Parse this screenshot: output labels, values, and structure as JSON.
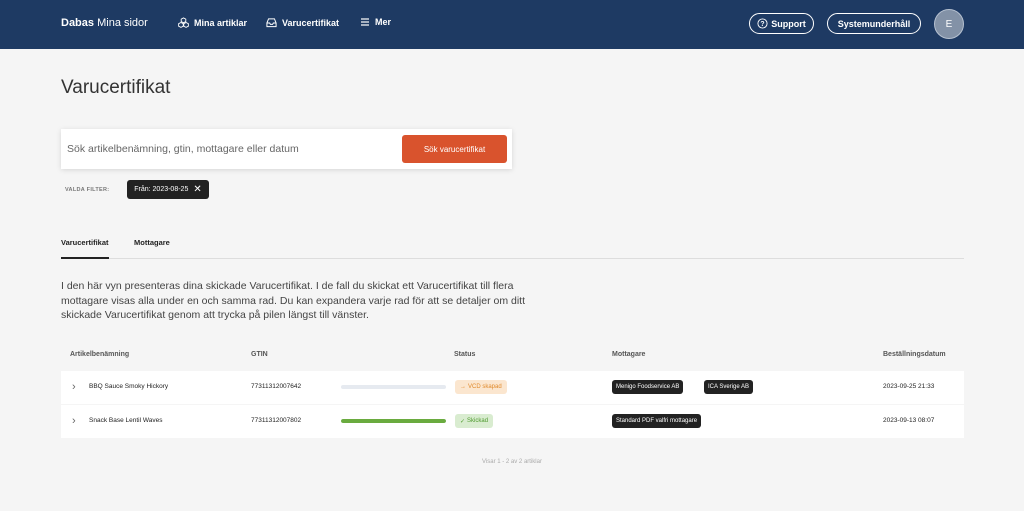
{
  "nav": {
    "brand_bold": "Dabas",
    "brand_rest": "Mina sidor",
    "links": [
      {
        "label": "Mina artiklar",
        "icon": "cubes-icon"
      },
      {
        "label": "Varucertifikat",
        "icon": "inbox-icon"
      },
      {
        "label": "Mer",
        "icon": "menu-icon"
      }
    ],
    "support_label": "Support",
    "maintenance_label": "Systemunderhåll",
    "avatar_initial": "E"
  },
  "page": {
    "title": "Varucertifikat"
  },
  "search": {
    "placeholder": "Sök artikelbenämning, gtin, mottagare eller datum",
    "value": "",
    "button_label": "Sök varucertifikat"
  },
  "filters": {
    "label": "VALDA FILTER:",
    "chips": [
      {
        "label": "Från: 2023-08-25"
      }
    ]
  },
  "tabs": [
    {
      "label": "Varucertifikat",
      "active": true
    },
    {
      "label": "Mottagare",
      "active": false
    }
  ],
  "description": "I den här vyn presenteras dina skickade Varucertifikat. I de fall du skickat ett Varucertifikat till flera mottagare visas alla under en och samma rad. Du kan expandera varje rad för att se detaljer om ditt skickade Varucertifikat genom att trycka på pilen längst till vänster.",
  "table": {
    "headers": {
      "name": "Artikelbenämning",
      "gtin": "GTIN",
      "status": "Status",
      "recipients": "Mottagare",
      "order_date": "Beställningsdatum"
    },
    "rows": [
      {
        "name": "BBQ Sauce Smoky Hickory",
        "gtin": "77311312007642",
        "progress": 0,
        "status": "VCD skapad",
        "status_icon": "→",
        "status_type": "pending",
        "recipients": [
          "Menigo Foodservice AB",
          "ICA Sverige AB"
        ],
        "order_date": "2023-09-25 21:33"
      },
      {
        "name": "Snack Base Lentil Waves",
        "gtin": "77311312007802",
        "progress": 1,
        "status": "Skickad",
        "status_icon": "✓",
        "status_type": "sent",
        "recipients": [
          "Standard PDF valfri mottagare"
        ],
        "order_date": "2023-09-13 08:07"
      }
    ]
  },
  "footer": "Visar 1 - 2 av 2 artiklar",
  "colors": {
    "nav_bg": "#1e3a63",
    "accent": "#d9532d",
    "progress_done": "#6aab3f",
    "status_pending_bg": "#fbe6cf",
    "status_sent_bg": "#d9ecd0"
  }
}
